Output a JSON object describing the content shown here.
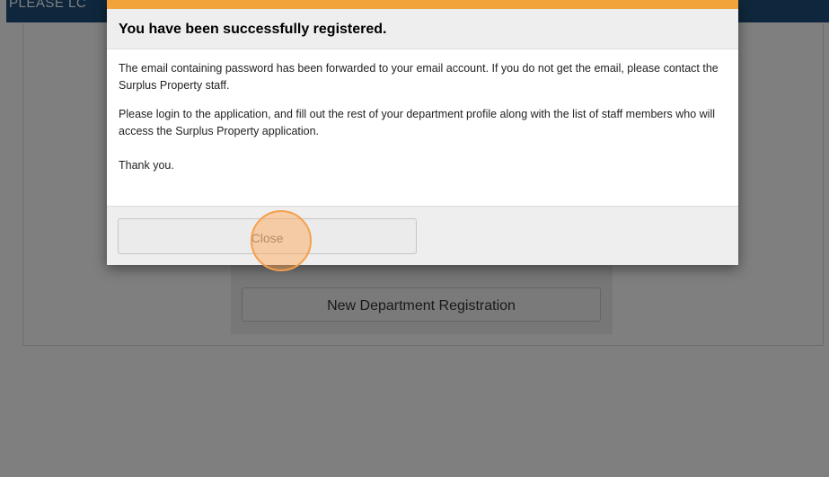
{
  "header": {
    "title": "PLEASE LC"
  },
  "login_panel": {
    "new_department_button_label": "New Department Registration"
  },
  "modal": {
    "title": "You have been successfully registered.",
    "paragraphs": [
      "The email containing password has been forwarded to your email account. If you do not get the email, please contact the Surplus Property staff.",
      "Please login to the application, and fill out the rest of your department profile along with the list of staff members who will access the Surplus Property application.",
      "Thank you."
    ],
    "close_button_label": "Close"
  },
  "colors": {
    "header_bar": "#1f4e79",
    "modal_accent": "#f2a43a",
    "click_marker": "#f4a04e",
    "backdrop": "rgba(0,0,0,0.5)"
  }
}
